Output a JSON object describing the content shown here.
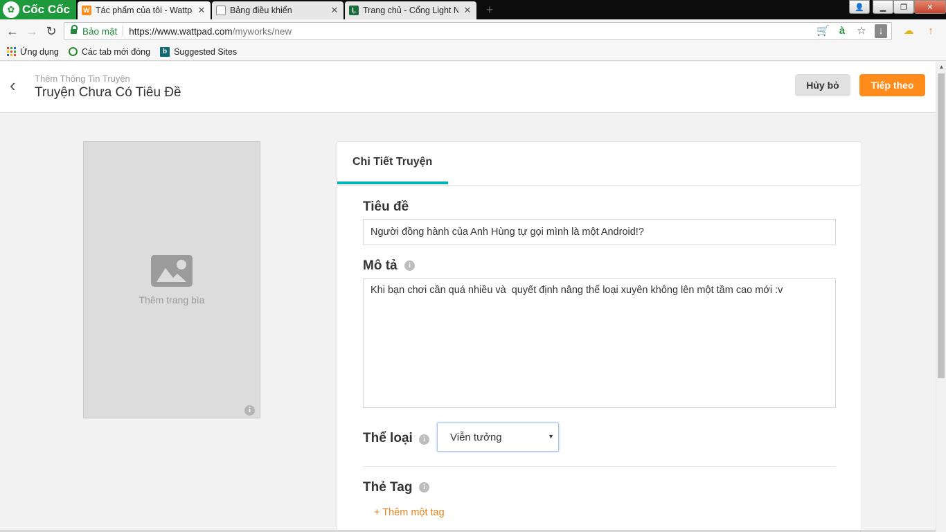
{
  "browser": {
    "brand": "Cốc Cốc",
    "tabs": [
      {
        "title": "Tác phẩm của tôi - Wattpad",
        "active": true
      },
      {
        "title": "Bảng điều khiển",
        "active": false
      },
      {
        "title": "Trang chủ - Cổng Light Novel",
        "active": false
      }
    ],
    "address": {
      "secure_label": "Bảo mật",
      "url_host": "https://www.wattpad.com",
      "url_path": "/myworks/new"
    },
    "bookmarks": [
      {
        "label": "Ứng dụng"
      },
      {
        "label": "Các tab mới đóng"
      },
      {
        "label": "Suggested Sites"
      }
    ]
  },
  "header": {
    "subtitle": "Thêm Thông Tin Truyện",
    "title": "Truyện Chưa Có Tiêu Đề",
    "cancel_label": "Hủy bỏ",
    "next_label": "Tiếp theo"
  },
  "cover": {
    "label": "Thêm trang bìa"
  },
  "details": {
    "tab_label": "Chi Tiết Truyện",
    "title_label": "Tiêu đề",
    "title_value": "Người đồng hành của Anh Hùng tự gọi mình là một Android!?",
    "description_label": "Mô tả",
    "description_value": "Khi bạn chơi cần quá nhiều và  quyết định nâng thể loại xuyên không lên một tầm cao mới :v",
    "genre_label": "Thể loại",
    "genre_value": "Viễn tưởng",
    "tags_label": "Thẻ Tag",
    "add_tag_label": "+ Thêm một tag"
  },
  "colors": {
    "accent_orange": "#ff8c1a",
    "tab_teal": "#00b2b2",
    "brand_green": "#1e9a3c"
  }
}
